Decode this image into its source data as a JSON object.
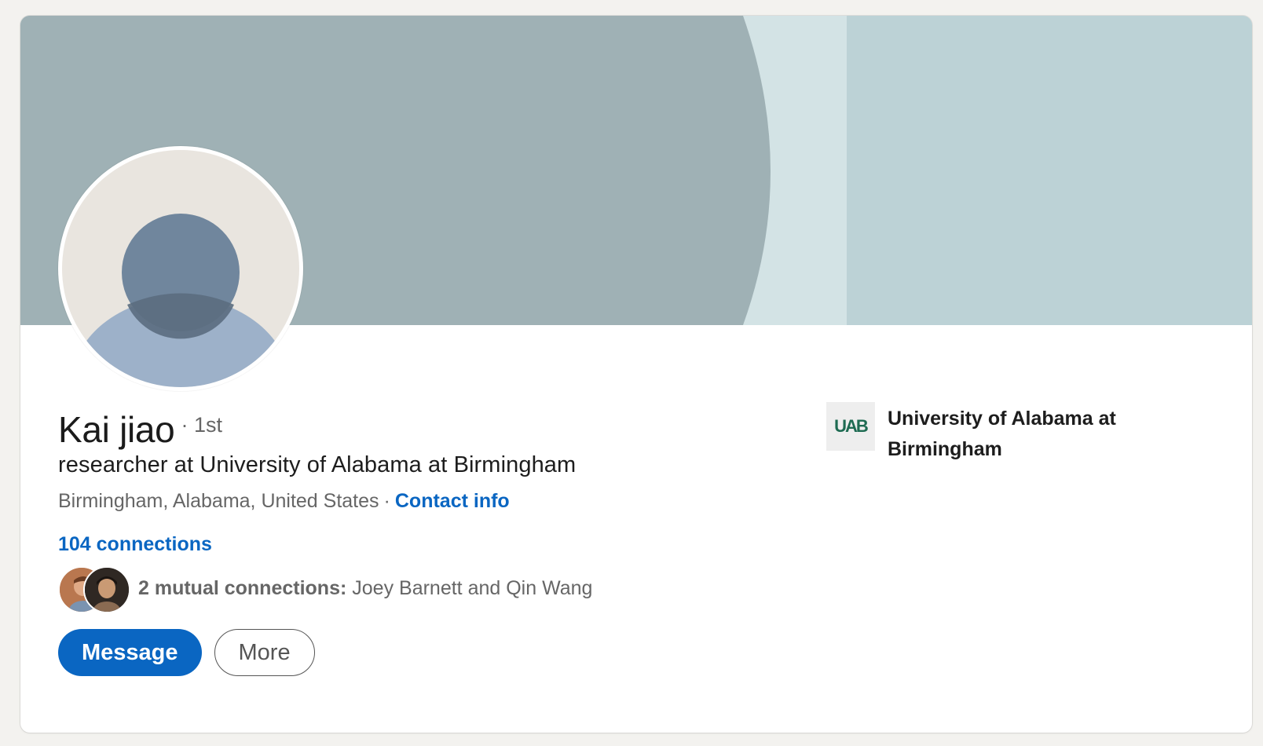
{
  "profile": {
    "name": "Kai jiao",
    "degree": "· 1st",
    "headline": "researcher at University of Alabama at Birmingham",
    "location": "Birmingham, Alabama, United States",
    "separator": "·",
    "contact_info_label": "Contact info",
    "connections_label": "104 connections",
    "mutual": {
      "count_label": "2 mutual connections:",
      "names": "Joey Barnett and Qin Wang"
    }
  },
  "actions": {
    "message_label": "Message",
    "more_label": "More"
  },
  "organization": {
    "logo_text": "UAB",
    "name": "University of Alabama at Birmingham"
  },
  "colors": {
    "accent": "#0a66c2",
    "banner_dark": "#9fb1b5",
    "banner_light": "#bcd2d6",
    "avatar_bg": "#e9e5df",
    "avatar_figure": "#70869d",
    "avatar_body": "#9db1c9"
  },
  "icons": {
    "avatar": "default-person-avatar-icon",
    "org_logo": "uab-logo"
  }
}
